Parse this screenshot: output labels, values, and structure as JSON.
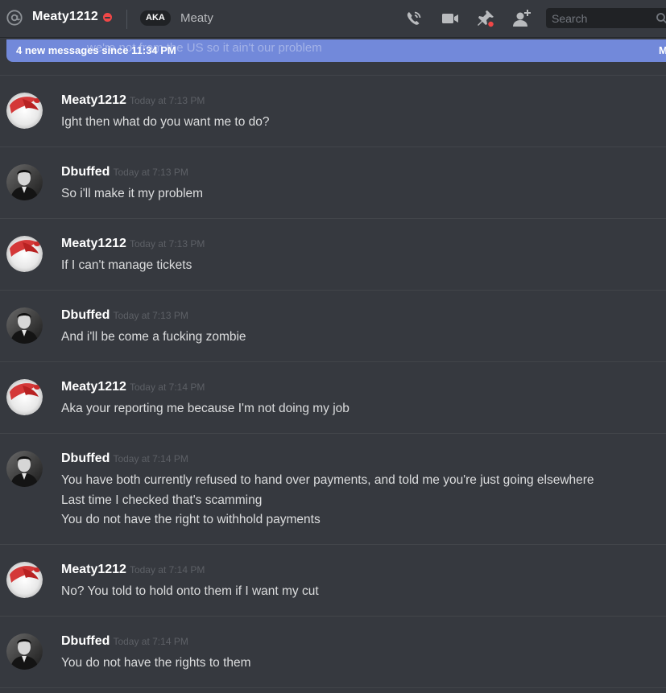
{
  "header": {
    "username": "Meaty1212",
    "aka_badge": "AKA",
    "aka_name": "Meaty",
    "search_placeholder": "Search",
    "icons": [
      "at-icon",
      "dnd-status-icon",
      "call-icon",
      "video-icon",
      "pin-icon",
      "add-friend-icon",
      "search-icon"
    ]
  },
  "new_messages_bar": {
    "label": "4 new messages since 11:34 PM",
    "mark_read": "M",
    "ghost_text": "we're not from the US so it ain't our problem"
  },
  "messages": [
    {
      "author": "Meaty1212",
      "timestamp": "Today at 7:13 PM",
      "lines": [
        "Ight then what do you want me to do?"
      ]
    },
    {
      "author": "Dbuffed",
      "timestamp": "Today at 7:13 PM",
      "lines": [
        "So i'll make it my problem"
      ]
    },
    {
      "author": "Meaty1212",
      "timestamp": "Today at 7:13 PM",
      "lines": [
        "If I can't manage tickets"
      ]
    },
    {
      "author": "Dbuffed",
      "timestamp": "Today at 7:13 PM",
      "lines": [
        "And i'll be come a fucking zombie"
      ]
    },
    {
      "author": "Meaty1212",
      "timestamp": "Today at 7:14 PM",
      "lines": [
        "Aka your reporting me because I'm not doing my job"
      ]
    },
    {
      "author": "Dbuffed",
      "timestamp": "Today at 7:14 PM",
      "lines": [
        "You have both currently refused to hand over payments, and told me you're just going elsewhere",
        "Last time I checked that's scamming",
        "You do not have the right to withhold payments"
      ]
    },
    {
      "author": "Meaty1212",
      "timestamp": "Today at 7:14 PM",
      "lines": [
        "No? You told to hold onto them if I want my cut"
      ]
    },
    {
      "author": "Dbuffed",
      "timestamp": "Today at 7:14 PM",
      "lines": [
        "You do not have the rights to them"
      ]
    }
  ],
  "colors": {
    "background": "#36393f",
    "accent": "#7289da",
    "dnd": "#f04747"
  }
}
